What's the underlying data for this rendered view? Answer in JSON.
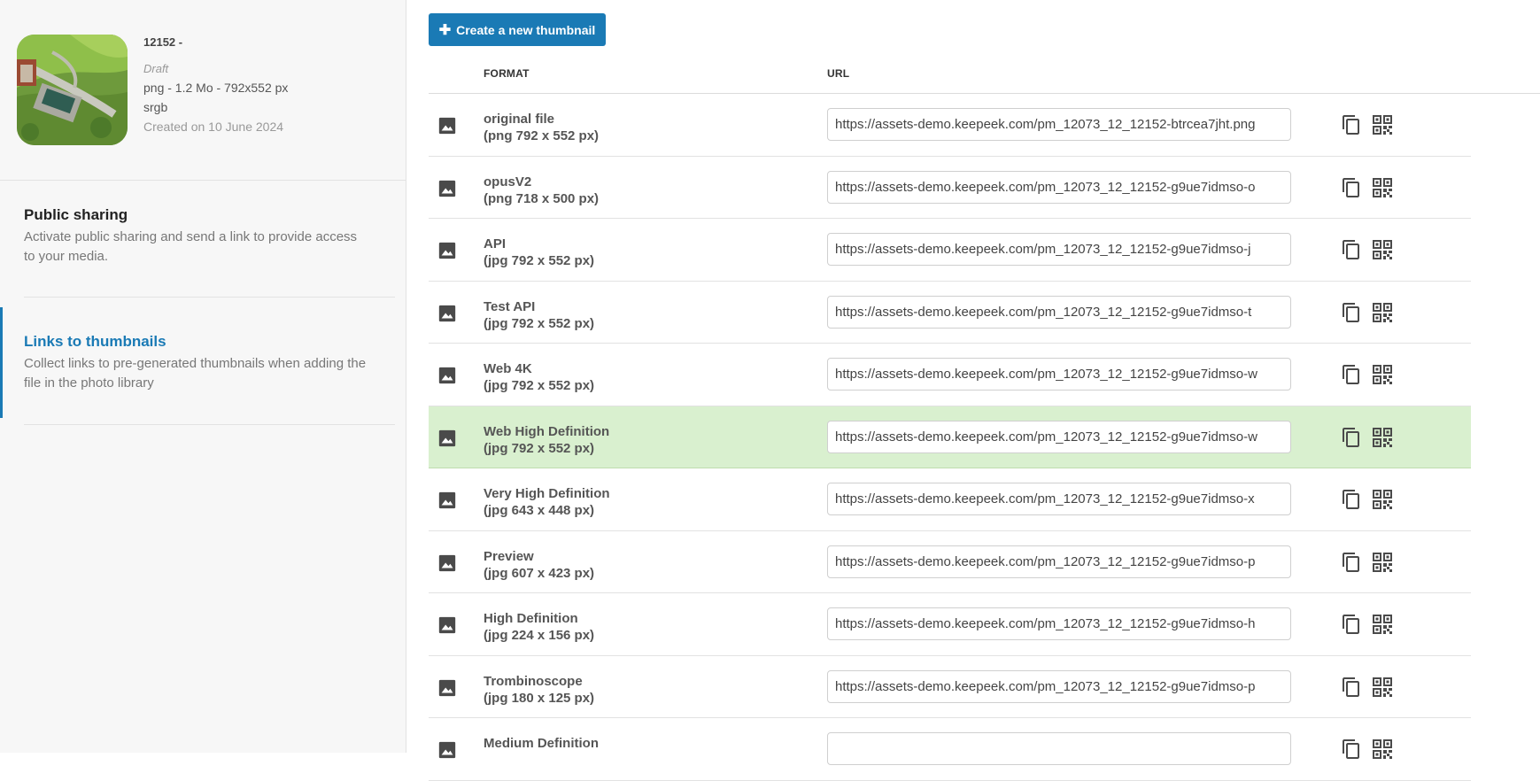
{
  "media": {
    "id": "12152 -",
    "status": "Draft",
    "info": "png - 1.2 Mo - 792x552 px",
    "color_space": "srgb",
    "created": "Created on 10 June 2024"
  },
  "nav": {
    "public_sharing": {
      "title": "Public sharing",
      "description": "Activate public sharing and send a link to provide access to your media."
    },
    "links_to_thumbnails": {
      "title": "Links to thumbnails",
      "description": "Collect links to pre-generated thumbnails when adding the file in the photo library"
    }
  },
  "toolbar": {
    "create_label": "Create a new thumbnail"
  },
  "columns": {
    "format": "FORMAT",
    "url": "URL"
  },
  "icons": {
    "row_image": "image-icon",
    "copy": "copy-icon",
    "qr": "qr-code-icon",
    "create": "plus-icon"
  },
  "colors": {
    "accent": "#1a7ab5",
    "highlight_row": "#d9f0cf"
  },
  "rows": [
    {
      "name": "original file",
      "spec": "(png 792 x 552 px)",
      "url": "https://assets-demo.keepeek.com/pm_12073_12_12152-btrcea7jht.png"
    },
    {
      "name": "opusV2",
      "spec": "(png 718 x 500 px)",
      "url": "https://assets-demo.keepeek.com/pm_12073_12_12152-g9ue7idmso-o"
    },
    {
      "name": "API",
      "spec": "(jpg 792 x 552 px)",
      "url": "https://assets-demo.keepeek.com/pm_12073_12_12152-g9ue7idmso-j"
    },
    {
      "name": "Test API",
      "spec": "(jpg 792 x 552 px)",
      "url": "https://assets-demo.keepeek.com/pm_12073_12_12152-g9ue7idmso-t"
    },
    {
      "name": "Web 4K",
      "spec": "(jpg 792 x 552 px)",
      "url": "https://assets-demo.keepeek.com/pm_12073_12_12152-g9ue7idmso-w"
    },
    {
      "name": "Web High Definition",
      "spec": "(jpg 792 x 552 px)",
      "url": "https://assets-demo.keepeek.com/pm_12073_12_12152-g9ue7idmso-w",
      "highlighted": true
    },
    {
      "name": "Very High Definition",
      "spec": "(jpg 643 x 448 px)",
      "url": "https://assets-demo.keepeek.com/pm_12073_12_12152-g9ue7idmso-x"
    },
    {
      "name": "Preview",
      "spec": "(jpg 607 x 423 px)",
      "url": "https://assets-demo.keepeek.com/pm_12073_12_12152-g9ue7idmso-p"
    },
    {
      "name": "High Definition",
      "spec": "(jpg 224 x 156 px)",
      "url": "https://assets-demo.keepeek.com/pm_12073_12_12152-g9ue7idmso-h"
    },
    {
      "name": "Trombinoscope",
      "spec": "(jpg 180 x 125 px)",
      "url": "https://assets-demo.keepeek.com/pm_12073_12_12152-g9ue7idmso-p"
    },
    {
      "name": "Medium Definition",
      "spec": "",
      "url": ""
    }
  ]
}
